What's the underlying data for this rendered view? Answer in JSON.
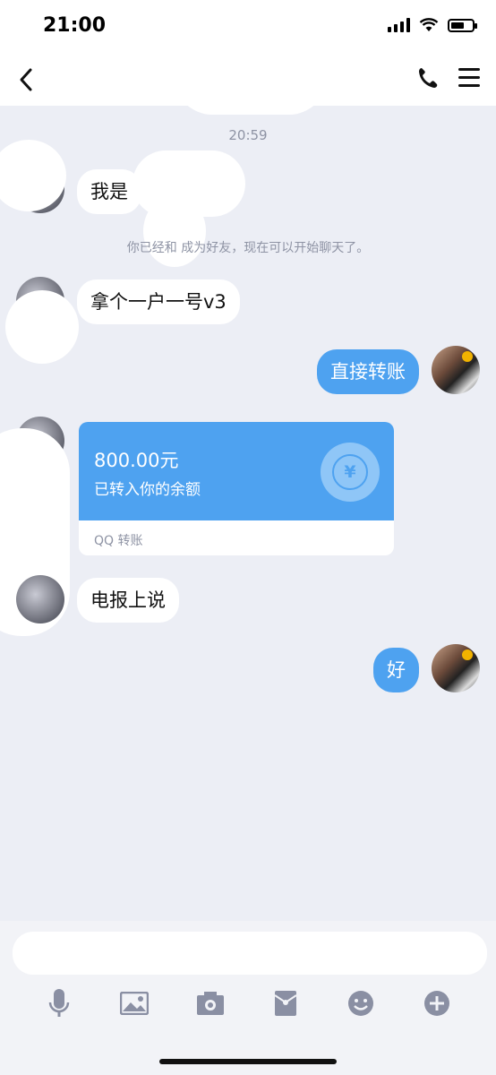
{
  "status": {
    "time": "21:00"
  },
  "header": {
    "back_icon": "chevron-left-icon"
  },
  "chat": {
    "timestamp": "20:59",
    "messages": [
      {
        "side": "in",
        "text": "我是"
      },
      {
        "side": "system",
        "text": "你已经和 成为好友，现在可以开始聊天了。"
      },
      {
        "side": "in",
        "text": "拿个一户一号v3"
      },
      {
        "side": "out",
        "text": "直接转账"
      },
      {
        "side": "in",
        "text": "电报上说"
      },
      {
        "side": "out",
        "text": "好"
      }
    ],
    "transfer": {
      "amount": "800.00元",
      "description": "已转入你的余额",
      "footer": "QQ 转账",
      "icon_glyph": "¥"
    }
  },
  "input": {
    "placeholder": ""
  },
  "colors": {
    "accent": "#4ea2f0",
    "background": "#eceef5"
  }
}
